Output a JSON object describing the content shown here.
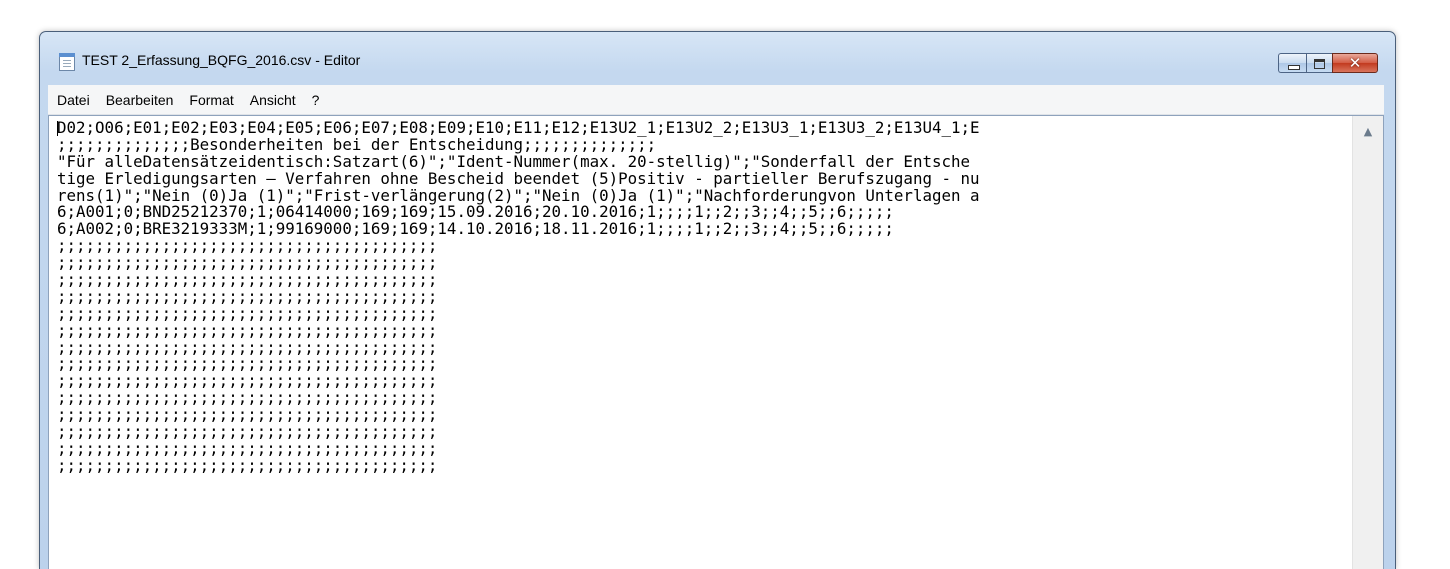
{
  "window": {
    "title": "TEST 2_Erfassung_BQFG_2016.csv - Editor"
  },
  "caption_buttons": {
    "close_glyph": "✕"
  },
  "menu": {
    "items": [
      "Datei",
      "Bearbeiten",
      "Format",
      "Ansicht",
      "?"
    ]
  },
  "icons": {
    "app": "notepad-icon",
    "scroll_up": "scroll-up-arrow-icon"
  },
  "editor": {
    "lines": [
      "D02;O06;E01;E02;E03;E04;E05;E06;E07;E08;E09;E10;E11;E12;E13U2_1;E13U2_2;E13U3_1;E13U3_2;E13U4_1;E",
      ";;;;;;;;;;;;;;Besonderheiten bei der Entscheidung;;;;;;;;;;;;;;",
      "\"Für alleDatensätzeidentisch:Satzart(6)\";\"Ident-Nummer(max. 20-stellig)\";\"Sonderfall der Entsche",
      "tige Erledigungsarten – Verfahren ohne Bescheid beendet (5)Positiv - partieller Berufszugang - nu",
      "rens(1)\";\"Nein (0)Ja (1)\";\"Frist-verlängerung(2)\";\"Nein (0)Ja (1)\";\"Nachforderungvon Unterlagen a",
      "6;A001;0;BND25212370;1;06414000;169;169;15.09.2016;20.10.2016;1;;;;1;;2;;3;;4;;5;;6;;;;;",
      "6;A002;0;BRE3219333M;1;99169000;169;169;14.10.2016;18.11.2016;1;;;;1;;2;;3;;4;;5;;6;;;;;",
      ";;;;;;;;;;;;;;;;;;;;;;;;;;;;;;;;;;;;;;;;",
      ";;;;;;;;;;;;;;;;;;;;;;;;;;;;;;;;;;;;;;;;",
      ";;;;;;;;;;;;;;;;;;;;;;;;;;;;;;;;;;;;;;;;",
      ";;;;;;;;;;;;;;;;;;;;;;;;;;;;;;;;;;;;;;;;",
      ";;;;;;;;;;;;;;;;;;;;;;;;;;;;;;;;;;;;;;;;",
      ";;;;;;;;;;;;;;;;;;;;;;;;;;;;;;;;;;;;;;;;",
      ";;;;;;;;;;;;;;;;;;;;;;;;;;;;;;;;;;;;;;;;",
      ";;;;;;;;;;;;;;;;;;;;;;;;;;;;;;;;;;;;;;;;",
      ";;;;;;;;;;;;;;;;;;;;;;;;;;;;;;;;;;;;;;;;",
      ";;;;;;;;;;;;;;;;;;;;;;;;;;;;;;;;;;;;;;;;",
      ";;;;;;;;;;;;;;;;;;;;;;;;;;;;;;;;;;;;;;;;",
      ";;;;;;;;;;;;;;;;;;;;;;;;;;;;;;;;;;;;;;;;",
      ";;;;;;;;;;;;;;;;;;;;;;;;;;;;;;;;;;;;;;;;",
      ";;;;;;;;;;;;;;;;;;;;;;;;;;;;;;;;;;;;;;;;"
    ]
  }
}
